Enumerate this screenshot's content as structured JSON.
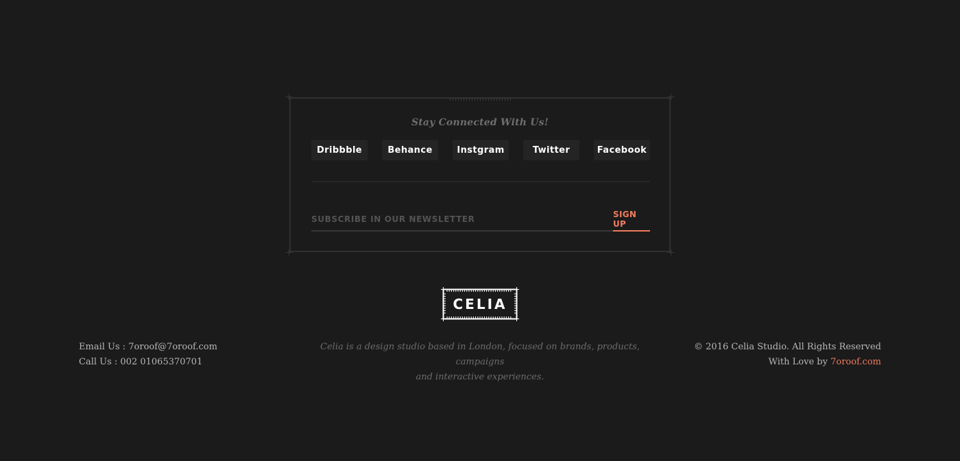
{
  "connect": {
    "title": "Stay Connected With Us!",
    "social": [
      {
        "label": "Dribbble"
      },
      {
        "label": "Behance"
      },
      {
        "label": "Instgram"
      },
      {
        "label": "Twitter"
      },
      {
        "label": "Facebook"
      }
    ]
  },
  "newsletter": {
    "placeholder": "Subscribe in our newsletter",
    "button_label": "Sign Up"
  },
  "logo": {
    "text": "CELIA"
  },
  "footer": {
    "email_line": "Email Us : 7oroof@7oroof.com",
    "phone_line": "Call Us : 002 01065370701",
    "tagline_line1": "Celia is a design studio based in London, focused on brands, products, campaigns",
    "tagline_line2": "and interactive experiences.",
    "copyright": "© 2016 Celia Studio. All Rights Reserved",
    "credit_prefix": "With Love by",
    "credit_link": "7oroof.com"
  },
  "colors": {
    "background": "#1b1b1b",
    "accent": "#f07c5f",
    "button_bg": "#242424",
    "frame": "#2f2f2f"
  }
}
